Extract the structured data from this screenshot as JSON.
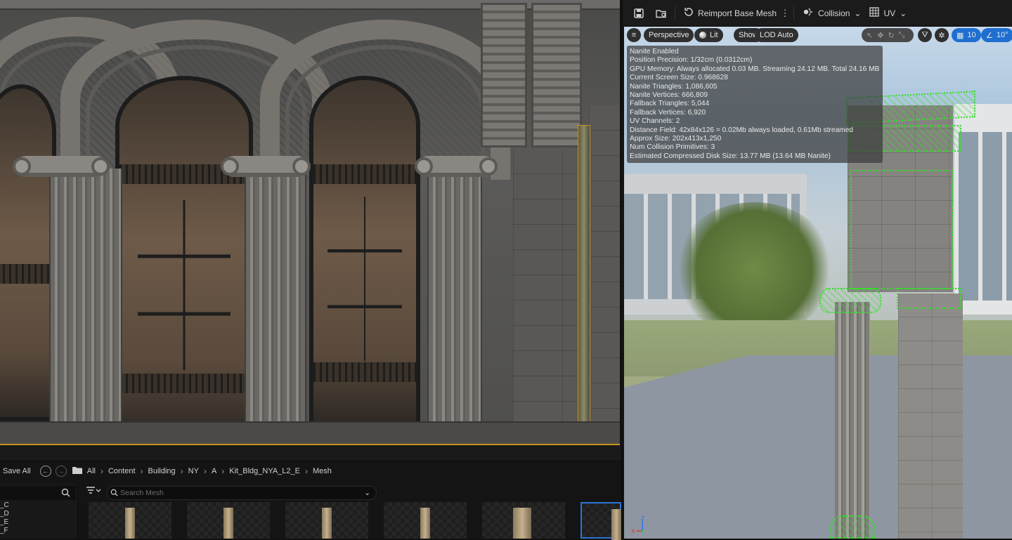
{
  "viewport_toolbar": {
    "reimport_label": "Reimport Base Mesh",
    "collision_label": "Collision",
    "uv_label": "UV"
  },
  "preview": {
    "perspective": "Perspective",
    "lit": "Lit",
    "show": "Show",
    "lod": "LOD Auto",
    "grid_value": "10",
    "angle_value": "10°",
    "axis_x": "X",
    "axis_z": "Z",
    "stats": [
      "Nanite Enabled",
      "Position Precision: 1/32cm (0.0312cm)",
      "GPU Memory: Always allocated 0.03 MB. Streaming 24.12 MB. Total 24.16 MB.",
      "Current Screen Size: 0.968628",
      "Nanite Triangles: 1,086,605",
      "Nanite Vertices: 666,809",
      "Fallback Triangles: 5,044",
      "Fallback Vertices: 6,920",
      "UV Channels: 2",
      "Distance Field: 42x84x126 = 0.02Mb always loaded, 0.61Mb streamed",
      "Approx Size: 202x413x1,250",
      "Num Collision Primitives: 3",
      "Estimated Compressed Disk Size: 13.77 MB (13.64 MB Nanite)"
    ]
  },
  "content_browser": {
    "save_all": "Save All",
    "breadcrumb": [
      "All",
      "Content",
      "Building",
      "NY",
      "A",
      "Kit_Bldg_NYA_L2_E",
      "Mesh"
    ],
    "search_placeholder": "Search Mesh",
    "folder_items": [
      "_C",
      "_D",
      "_E",
      "_F"
    ]
  },
  "icons": {
    "save": "save-icon",
    "browse": "browse-asset-icon",
    "collision": "collision-icon",
    "uv": "uv-grid-icon",
    "hamburger": "hamburger-menu-icon",
    "lit": "lit-sphere-icon",
    "grid": "grid-snap-icon",
    "angle": "angle-snap-icon"
  },
  "colors": {
    "accent_blue": "#1f6fd1",
    "selection_orange": "#c8941e",
    "collision_green": "#35e02a"
  }
}
